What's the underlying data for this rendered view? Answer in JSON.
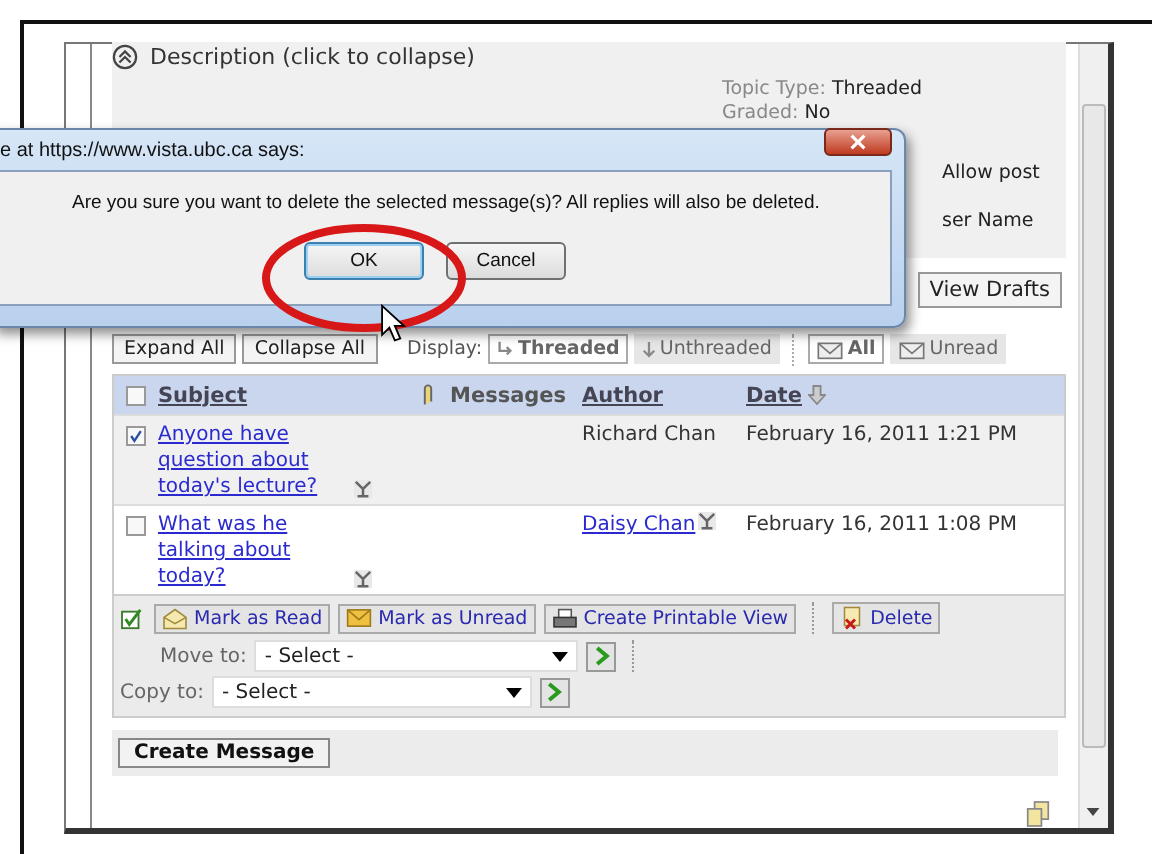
{
  "description": {
    "label": "Description (click to collapse)",
    "expanded": true
  },
  "topic_info": [
    {
      "label": "Topic Type:",
      "value": "Threaded"
    },
    {
      "label": "Graded:",
      "value": "No"
    }
  ],
  "info_fragments": [
    "Allow post",
    "ser Name"
  ],
  "view_drafts_button": "View Drafts",
  "toolbar": {
    "expand_all": "Expand All",
    "collapse_all": "Collapse All",
    "display_label": "Display:",
    "display_options": [
      {
        "label": "Threaded",
        "selected": true
      },
      {
        "label": "Unthreaded",
        "selected": false
      }
    ],
    "filters": [
      {
        "label": "All",
        "selected": true
      },
      {
        "label": "Unread",
        "selected": false
      }
    ]
  },
  "table": {
    "select_all": {
      "checked": false
    },
    "columns": [
      {
        "label": "Subject",
        "link": true,
        "sorted": false
      },
      {
        "label": "Messages",
        "link": false,
        "sorted": false
      },
      {
        "label": "Author",
        "link": true,
        "sorted": false
      },
      {
        "label": "Date",
        "link": true,
        "sorted": true
      }
    ],
    "rows": [
      {
        "subject": "Anyone have question about today's lecture?",
        "author": "Richard Chan",
        "author_link": false,
        "date": "February 16, 2011 1:21 PM",
        "selected": true
      },
      {
        "subject": "What was he talking about today?",
        "author": "Daisy Chan",
        "author_link": true,
        "date": "February 16, 2011 1:08 PM",
        "selected": false
      }
    ]
  },
  "actions": [
    {
      "kind": "read",
      "label": "Mark as Read"
    },
    {
      "kind": "unread",
      "label": "Mark as Unread"
    },
    {
      "kind": "print",
      "label": "Create Printable View"
    },
    {
      "kind": "delete",
      "label": "Delete"
    }
  ],
  "move_to": {
    "label": "Move to:",
    "value": "- Select -"
  },
  "copy_to": {
    "label": "Copy to:",
    "value": "- Select -"
  },
  "create_message": "Create Message",
  "dialog": {
    "title": "e at https://www.vista.ubc.ca says:",
    "message": "Are you sure you want to delete the selected message(s)? All replies will also be deleted.",
    "buttons": [
      {
        "label": "OK",
        "focused": true
      },
      {
        "label": "Cancel",
        "focused": false
      }
    ]
  }
}
